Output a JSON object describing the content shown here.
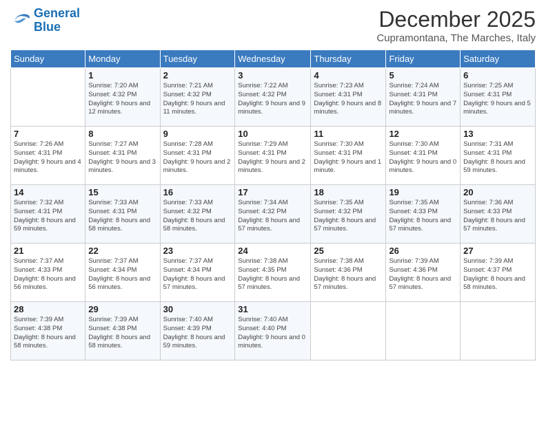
{
  "logo": {
    "line1": "General",
    "line2": "Blue"
  },
  "title": "December 2025",
  "subtitle": "Cupramontana, The Marches, Italy",
  "header": {
    "days": [
      "Sunday",
      "Monday",
      "Tuesday",
      "Wednesday",
      "Thursday",
      "Friday",
      "Saturday"
    ]
  },
  "weeks": [
    [
      {
        "day": "",
        "info": ""
      },
      {
        "day": "1",
        "info": "Sunrise: 7:20 AM\nSunset: 4:32 PM\nDaylight: 9 hours\nand 12 minutes."
      },
      {
        "day": "2",
        "info": "Sunrise: 7:21 AM\nSunset: 4:32 PM\nDaylight: 9 hours\nand 11 minutes."
      },
      {
        "day": "3",
        "info": "Sunrise: 7:22 AM\nSunset: 4:32 PM\nDaylight: 9 hours\nand 9 minutes."
      },
      {
        "day": "4",
        "info": "Sunrise: 7:23 AM\nSunset: 4:31 PM\nDaylight: 9 hours\nand 8 minutes."
      },
      {
        "day": "5",
        "info": "Sunrise: 7:24 AM\nSunset: 4:31 PM\nDaylight: 9 hours\nand 7 minutes."
      },
      {
        "day": "6",
        "info": "Sunrise: 7:25 AM\nSunset: 4:31 PM\nDaylight: 9 hours\nand 5 minutes."
      }
    ],
    [
      {
        "day": "7",
        "info": "Sunrise: 7:26 AM\nSunset: 4:31 PM\nDaylight: 9 hours\nand 4 minutes."
      },
      {
        "day": "8",
        "info": "Sunrise: 7:27 AM\nSunset: 4:31 PM\nDaylight: 9 hours\nand 3 minutes."
      },
      {
        "day": "9",
        "info": "Sunrise: 7:28 AM\nSunset: 4:31 PM\nDaylight: 9 hours\nand 2 minutes."
      },
      {
        "day": "10",
        "info": "Sunrise: 7:29 AM\nSunset: 4:31 PM\nDaylight: 9 hours\nand 2 minutes."
      },
      {
        "day": "11",
        "info": "Sunrise: 7:30 AM\nSunset: 4:31 PM\nDaylight: 9 hours\nand 1 minute."
      },
      {
        "day": "12",
        "info": "Sunrise: 7:30 AM\nSunset: 4:31 PM\nDaylight: 9 hours\nand 0 minutes."
      },
      {
        "day": "13",
        "info": "Sunrise: 7:31 AM\nSunset: 4:31 PM\nDaylight: 8 hours\nand 59 minutes."
      }
    ],
    [
      {
        "day": "14",
        "info": "Sunrise: 7:32 AM\nSunset: 4:31 PM\nDaylight: 8 hours\nand 59 minutes."
      },
      {
        "day": "15",
        "info": "Sunrise: 7:33 AM\nSunset: 4:31 PM\nDaylight: 8 hours\nand 58 minutes."
      },
      {
        "day": "16",
        "info": "Sunrise: 7:33 AM\nSunset: 4:32 PM\nDaylight: 8 hours\nand 58 minutes."
      },
      {
        "day": "17",
        "info": "Sunrise: 7:34 AM\nSunset: 4:32 PM\nDaylight: 8 hours\nand 57 minutes."
      },
      {
        "day": "18",
        "info": "Sunrise: 7:35 AM\nSunset: 4:32 PM\nDaylight: 8 hours\nand 57 minutes."
      },
      {
        "day": "19",
        "info": "Sunrise: 7:35 AM\nSunset: 4:33 PM\nDaylight: 8 hours\nand 57 minutes."
      },
      {
        "day": "20",
        "info": "Sunrise: 7:36 AM\nSunset: 4:33 PM\nDaylight: 8 hours\nand 57 minutes."
      }
    ],
    [
      {
        "day": "21",
        "info": "Sunrise: 7:37 AM\nSunset: 4:33 PM\nDaylight: 8 hours\nand 56 minutes."
      },
      {
        "day": "22",
        "info": "Sunrise: 7:37 AM\nSunset: 4:34 PM\nDaylight: 8 hours\nand 56 minutes."
      },
      {
        "day": "23",
        "info": "Sunrise: 7:37 AM\nSunset: 4:34 PM\nDaylight: 8 hours\nand 57 minutes."
      },
      {
        "day": "24",
        "info": "Sunrise: 7:38 AM\nSunset: 4:35 PM\nDaylight: 8 hours\nand 57 minutes."
      },
      {
        "day": "25",
        "info": "Sunrise: 7:38 AM\nSunset: 4:36 PM\nDaylight: 8 hours\nand 57 minutes."
      },
      {
        "day": "26",
        "info": "Sunrise: 7:39 AM\nSunset: 4:36 PM\nDaylight: 8 hours\nand 57 minutes."
      },
      {
        "day": "27",
        "info": "Sunrise: 7:39 AM\nSunset: 4:37 PM\nDaylight: 8 hours\nand 58 minutes."
      }
    ],
    [
      {
        "day": "28",
        "info": "Sunrise: 7:39 AM\nSunset: 4:38 PM\nDaylight: 8 hours\nand 58 minutes."
      },
      {
        "day": "29",
        "info": "Sunrise: 7:39 AM\nSunset: 4:38 PM\nDaylight: 8 hours\nand 58 minutes."
      },
      {
        "day": "30",
        "info": "Sunrise: 7:40 AM\nSunset: 4:39 PM\nDaylight: 8 hours\nand 59 minutes."
      },
      {
        "day": "31",
        "info": "Sunrise: 7:40 AM\nSunset: 4:40 PM\nDaylight: 9 hours\nand 0 minutes."
      },
      {
        "day": "",
        "info": ""
      },
      {
        "day": "",
        "info": ""
      },
      {
        "day": "",
        "info": ""
      }
    ]
  ]
}
